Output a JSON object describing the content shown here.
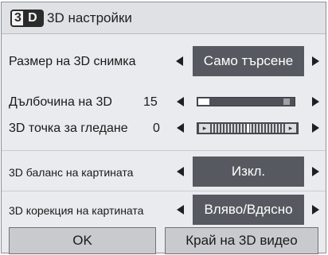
{
  "window": {
    "badge_3": "3",
    "badge_d": "D",
    "title": "3D настройки"
  },
  "rows": [
    {
      "label": "Размер на 3D снимка",
      "value": "Само търсене"
    },
    {
      "label": "Дълбочина на 3D",
      "value": "15",
      "level": 0.12
    },
    {
      "label": "3D точка за гледане",
      "value": "0",
      "level": 0.5
    },
    {
      "label": "3D баланс на картината",
      "value": "Изкл."
    },
    {
      "label": "3D корекция на картината",
      "value": "Вляво/Вдясно"
    }
  ],
  "buttons": {
    "ok": "OK",
    "end": "Край на 3D видео"
  },
  "colors": {
    "panel": "#e9ebee",
    "field": "#565a60",
    "button": "#c8cace"
  },
  "icons": [
    "3d-badge-icon",
    "left-arrow-icon",
    "right-arrow-icon"
  ]
}
